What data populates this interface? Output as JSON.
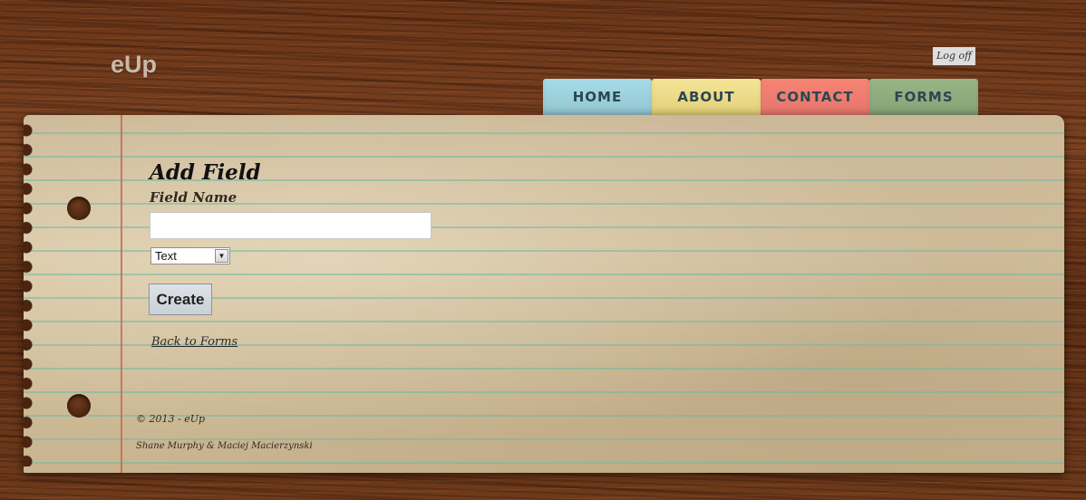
{
  "header": {
    "logo": "eUp",
    "logoff_label": "Log off"
  },
  "nav": {
    "tabs": [
      {
        "label": "HOME",
        "color": "#a6dbe9"
      },
      {
        "label": "ABOUT",
        "color": "#f5e597"
      },
      {
        "label": "CONTACT",
        "color": "#f58473"
      },
      {
        "label": "FORMS",
        "color": "#98b585"
      }
    ]
  },
  "form": {
    "title": "Add Field",
    "field_name_label": "Field Name",
    "field_name_value": "",
    "type_select_value": "Text",
    "create_label": "Create",
    "back_link": "Back to Forms"
  },
  "footer": {
    "copyright": "© 2013 - eUp",
    "authors": "Shane Murphy & Maciej Macierzynski"
  }
}
